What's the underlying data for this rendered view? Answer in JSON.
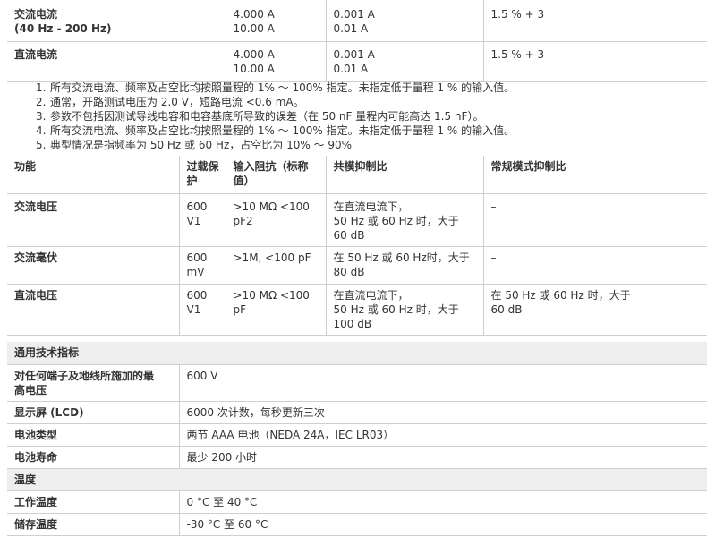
{
  "spec_top": {
    "rows": [
      {
        "label_lines": [
          "交流电流",
          "(40 Hz - 200 Hz)"
        ],
        "range": [
          "4.000 A",
          "10.00 A"
        ],
        "resolution": [
          "0.001 A",
          "0.01 A"
        ],
        "accuracy": "1.5 % + 3"
      },
      {
        "label_lines": [
          "直流电流"
        ],
        "range": [
          "4.000 A",
          "10.00 A"
        ],
        "resolution": [
          "0.001 A",
          "0.01 A"
        ],
        "accuracy": "1.5 % + 3"
      }
    ]
  },
  "notes": [
    {
      "num": "1.",
      "text": "所有交流电流、频率及占空比均按照量程的 1% ～ 100% 指定。未指定低于量程 1 % 的输入值。"
    },
    {
      "num": "2.",
      "text": "通常，开路测试电压为 2.0 V，短路电流 <0.6 mA。"
    },
    {
      "num": "3.",
      "text": "参数不包括因测试导线电容和电容基底所导致的误差（在 50 nF 量程内可能高达 1.5 nF）。"
    },
    {
      "num": "4.",
      "text": "所有交流电流、频率及占空比均按照量程的 1% ～ 100% 指定。未指定低于量程 1 % 的输入值。"
    },
    {
      "num": "5.",
      "text": "典型情况是指频率为 50 Hz 或 60 Hz，占空比为 10% ～ 90%"
    }
  ],
  "impedance_table": {
    "headers": {
      "function": "功能",
      "overload_lines": [
        "过载保",
        "护"
      ],
      "input_lines": [
        "输入阻抗（标称",
        "值）"
      ],
      "common_mode": "共模抑制比",
      "normal_mode": "常规模式抑制比"
    },
    "rows": [
      {
        "function": "交流电压",
        "overload": [
          "600",
          "V1"
        ],
        "input": [
          ">10 MΩ <100",
          "pF2"
        ],
        "common": [
          "在直流电流下，",
          "50 Hz 或 60 Hz 时，大于",
          "60 dB"
        ],
        "normal": [
          "–"
        ]
      },
      {
        "function": "交流毫伏",
        "overload": [
          "600",
          "mV"
        ],
        "input": [
          ">1M, <100 pF"
        ],
        "common": [
          "在 50 Hz 或 60 Hz时，大于",
          "80 dB"
        ],
        "normal": [
          "–"
        ]
      },
      {
        "function": "直流电压",
        "overload": [
          "600",
          "V1"
        ],
        "input": [
          ">10 MΩ <100",
          "pF"
        ],
        "common": [
          "在直流电流下，",
          "50 Hz 或 60 Hz 时，大于",
          "100 dB"
        ],
        "normal": [
          "在 50 Hz 或 60 Hz 时，大于",
          "60 dB"
        ]
      }
    ]
  },
  "general": {
    "section_general": "通用技术指标",
    "max_voltage_label_lines": [
      "对任何端子及地线所施加的最",
      "高电压"
    ],
    "max_voltage_value": "600 V",
    "display_label": "显示屏 (LCD)",
    "display_value": "6000 次计数，每秒更新三次",
    "battery_type_label": "电池类型",
    "battery_type_value": "两节 AAA 电池（NEDA 24A，IEC LR03）",
    "battery_life_label": "电池寿命",
    "battery_life_value": "最少 200 小时",
    "section_temperature": "温度",
    "operating_label": "工作温度",
    "operating_value": "0 °C 至 40 °C",
    "storage_label": "储存温度",
    "storage_value": "-30 °C 至 60 °C"
  }
}
